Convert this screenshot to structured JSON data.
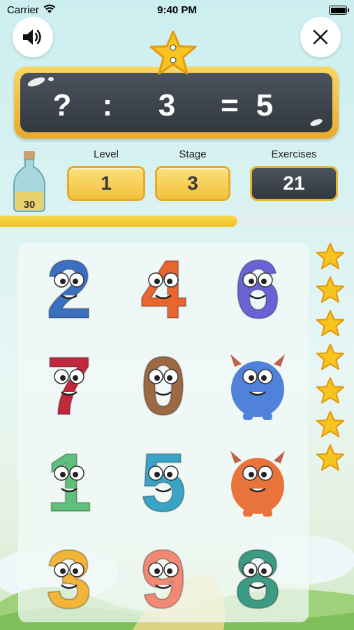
{
  "status_bar": {
    "carrier": "Carrier",
    "time": "9:40 PM"
  },
  "top_bar": {
    "sound_icon": "speaker-icon",
    "close_icon": "close-icon"
  },
  "equation": {
    "left": "?",
    "operator": ":",
    "divisor": "3",
    "equals": "=",
    "result": "5"
  },
  "stats": {
    "level_label": "Level",
    "level_value": "1",
    "stage_label": "Stage",
    "stage_value": "3",
    "exercises_label": "Exercises",
    "exercises_value": "21"
  },
  "bottle": {
    "count": "30"
  },
  "progress": {
    "fraction": 0.67
  },
  "colors": {
    "gold": "#f2c23b",
    "board_dark": "#3b4149",
    "star": "#f7c51d"
  },
  "number_cards": [
    {
      "digit": "2",
      "color": "#3b6fc0"
    },
    {
      "digit": "4",
      "color": "#e8662f"
    },
    {
      "digit": "6",
      "color": "#6a63d6"
    },
    {
      "digit": "7",
      "color": "#c2283b"
    },
    {
      "digit": "0",
      "color": "#9b6a45"
    },
    {
      "digit": "monster",
      "color": "#4f82d8"
    },
    {
      "digit": "1",
      "color": "#5fbf7b"
    },
    {
      "digit": "5",
      "color": "#3aa4c6"
    },
    {
      "digit": "monster",
      "color": "#e8743c"
    },
    {
      "digit": "3",
      "color": "#f2b53a"
    },
    {
      "digit": "9",
      "color": "#f08a74"
    },
    {
      "digit": "8",
      "color": "#3c9b85"
    }
  ],
  "stars_collected": 7
}
